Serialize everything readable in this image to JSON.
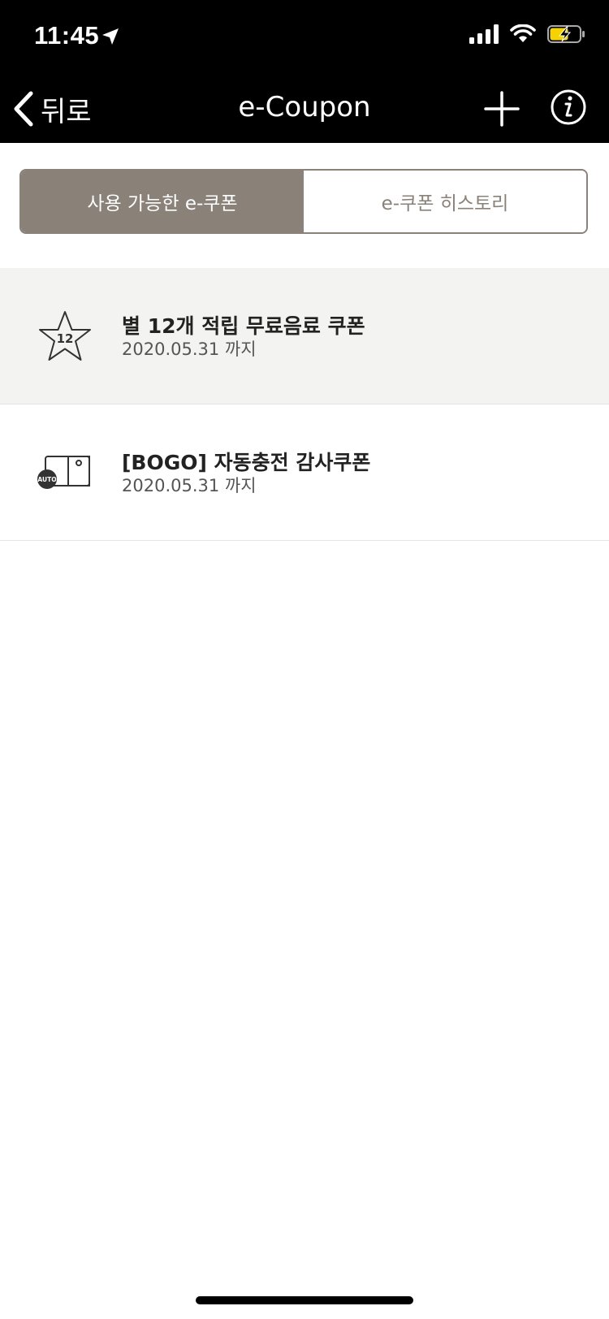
{
  "status_bar": {
    "time": "11:45"
  },
  "nav": {
    "back_label": "뒤로",
    "title": "e-Coupon"
  },
  "tabs": [
    {
      "label": "사용 가능한 e-쿠폰",
      "active": true
    },
    {
      "label": "e-쿠폰 히스토리",
      "active": false
    }
  ],
  "coupons": [
    {
      "title": "별 12개 적립 무료음료 쿠폰",
      "expiry": "2020.05.31 까지",
      "icon": "star-12-icon",
      "star_count": "12"
    },
    {
      "title": "[BOGO] 자동충전 감사쿠폰",
      "expiry": "2020.05.31 까지",
      "icon": "auto-card-icon",
      "badge": "AUTO"
    }
  ],
  "colors": {
    "bar_bg": "#000000",
    "accent": "#8a8178",
    "row_highlight": "#f3f3f2",
    "battery_fill": "#f5d200"
  }
}
